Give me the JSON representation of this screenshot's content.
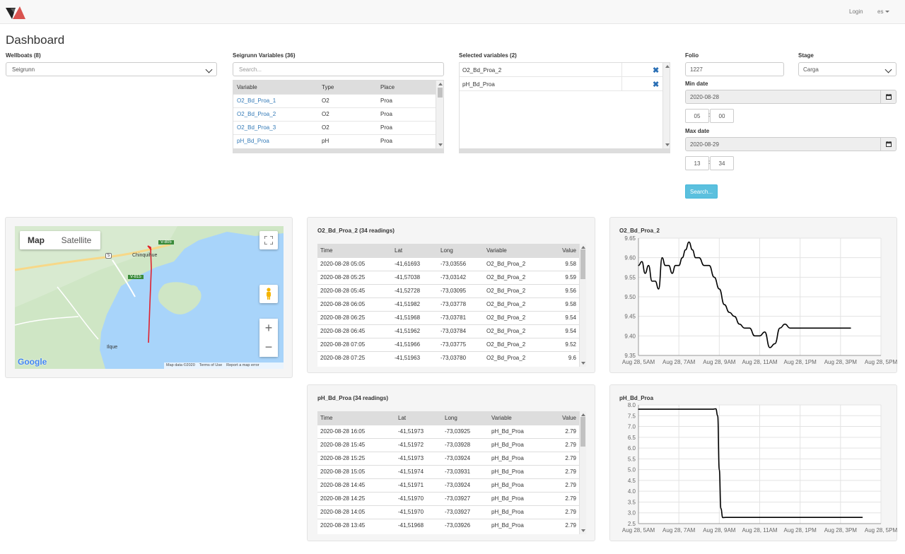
{
  "nav": {
    "login": "Login",
    "lang": "es"
  },
  "page_title": "Dashboard",
  "wellboats": {
    "label": "Wellboats (8)",
    "value": "Seigrunn"
  },
  "variables": {
    "label": "Seigrunn Variables (36)",
    "search_placeholder": "Search...",
    "columns": [
      "Variable",
      "Type",
      "Place"
    ],
    "rows": [
      [
        "O2_Bd_Proa_1",
        "O2",
        "Proa"
      ],
      [
        "O2_Bd_Proa_2",
        "O2",
        "Proa"
      ],
      [
        "O2_Bd_Proa_3",
        "O2",
        "Proa"
      ],
      [
        "pH_Bd_Proa",
        "pH",
        "Proa"
      ]
    ]
  },
  "selected": {
    "label": "Selected variables (2)",
    "items": [
      "O2_Bd_Proa_2",
      "pH_Bd_Proa"
    ]
  },
  "folio": {
    "label": "Folio",
    "value": "1227"
  },
  "stage": {
    "label": "Stage",
    "value": "Carga"
  },
  "min_date": {
    "label": "Min date",
    "value": "2020-08-28",
    "hour": "05",
    "minute": "00"
  },
  "max_date": {
    "label": "Max date",
    "value": "2020-08-29",
    "hour": "13",
    "minute": "34"
  },
  "search_button": "Search...",
  "map": {
    "tab_map": "Map",
    "tab_satellite": "Satellite",
    "places": [
      "Chinquihue",
      "Ilque"
    ],
    "roads": [
      "V-805",
      "V-815",
      "5"
    ],
    "google": "Google",
    "attribution": [
      "Map data ©2020",
      "Terms of Use",
      "Report a map error"
    ],
    "colors": {
      "water": "#a8d4fa",
      "land": "#cfe6c5",
      "track": "#e0202d"
    }
  },
  "table_o2": {
    "title": "O2_Bd_Proa_2 (34 readings)",
    "columns": [
      "Time",
      "Lat",
      "Long",
      "Variable",
      "Value"
    ],
    "rows": [
      [
        "2020-08-28 05:05",
        "-41,61693",
        "-73,03556",
        "O2_Bd_Proa_2",
        "9.58"
      ],
      [
        "2020-08-28 05:25",
        "-41,57038",
        "-73,03142",
        "O2_Bd_Proa_2",
        "9.59"
      ],
      [
        "2020-08-28 05:45",
        "-41,52728",
        "-73,03095",
        "O2_Bd_Proa_2",
        "9.56"
      ],
      [
        "2020-08-28 06:05",
        "-41,51982",
        "-73,03778",
        "O2_Bd_Proa_2",
        "9.58"
      ],
      [
        "2020-08-28 06:25",
        "-41,51968",
        "-73,03781",
        "O2_Bd_Proa_2",
        "9.54"
      ],
      [
        "2020-08-28 06:45",
        "-41,51962",
        "-73,03784",
        "O2_Bd_Proa_2",
        "9.54"
      ],
      [
        "2020-08-28 07:05",
        "-41,51966",
        "-73,03775",
        "O2_Bd_Proa_2",
        "9.52"
      ],
      [
        "2020-08-28 07:25",
        "-41,51963",
        "-73,03780",
        "O2_Bd_Proa_2",
        "9.6"
      ]
    ]
  },
  "table_ph": {
    "title": "pH_Bd_Proa (34 readings)",
    "columns": [
      "Time",
      "Lat",
      "Long",
      "Variable",
      "Value"
    ],
    "rows": [
      [
        "2020-08-28 16:05",
        "-41,51973",
        "-73,03925",
        "pH_Bd_Proa",
        "2.79"
      ],
      [
        "2020-08-28 15:45",
        "-41,51972",
        "-73,03928",
        "pH_Bd_Proa",
        "2.79"
      ],
      [
        "2020-08-28 15:25",
        "-41,51973",
        "-73,03924",
        "pH_Bd_Proa",
        "2.79"
      ],
      [
        "2020-08-28 15:05",
        "-41,51974",
        "-73,03931",
        "pH_Bd_Proa",
        "2.79"
      ],
      [
        "2020-08-28 14:45",
        "-41,51971",
        "-73,03924",
        "pH_Bd_Proa",
        "2.79"
      ],
      [
        "2020-08-28 14:25",
        "-41,51970",
        "-73,03927",
        "pH_Bd_Proa",
        "2.79"
      ],
      [
        "2020-08-28 14:05",
        "-41,51970",
        "-73,03927",
        "pH_Bd_Proa",
        "2.79"
      ],
      [
        "2020-08-28 13:45",
        "-41,51968",
        "-73,03926",
        "pH_Bd_Proa",
        "2.79"
      ]
    ]
  },
  "chart_data": [
    {
      "type": "line",
      "title": "O2_Bd_Proa_2",
      "x_ticks": [
        "Aug 28, 5AM",
        "Aug 28, 7AM",
        "Aug 28, 9AM",
        "Aug 28, 11AM",
        "Aug 28, 1PM",
        "Aug 28, 3PM",
        "Aug 28, 5PM"
      ],
      "xlim": [
        5,
        17
      ],
      "ylim": [
        9.35,
        9.65
      ],
      "y_ticks": [
        "9.35",
        "9.40",
        "9.45",
        "9.50",
        "9.55",
        "9.60",
        "9.65"
      ],
      "grid": true,
      "color": "#000000",
      "x": [
        5.0,
        5.17,
        5.33,
        5.5,
        5.67,
        5.83,
        6.0,
        6.17,
        6.33,
        6.5,
        6.67,
        6.83,
        7.0,
        7.17,
        7.33,
        7.5,
        7.67,
        7.83,
        8.0,
        8.25,
        8.5,
        8.75,
        9.0,
        9.25,
        9.5,
        9.75,
        10.0,
        10.25,
        10.5,
        10.75,
        11.0,
        11.25,
        11.5,
        11.75,
        12.0,
        12.25,
        12.5,
        12.75,
        13.0,
        13.25,
        13.5,
        13.75,
        14.0,
        14.25,
        14.5,
        14.75,
        15.0,
        15.17,
        15.33,
        15.5
      ],
      "values": [
        9.58,
        9.59,
        9.56,
        9.58,
        9.54,
        9.54,
        9.52,
        9.6,
        9.58,
        9.58,
        9.56,
        9.58,
        9.58,
        9.6,
        9.62,
        9.64,
        9.62,
        9.6,
        9.6,
        9.58,
        9.58,
        9.55,
        9.52,
        9.48,
        9.46,
        9.45,
        9.43,
        9.42,
        9.42,
        9.4,
        9.4,
        9.41,
        9.37,
        9.38,
        9.42,
        9.43,
        9.42,
        9.42,
        9.42,
        9.42,
        9.42,
        9.42,
        9.42,
        9.42,
        9.42,
        9.42,
        9.42,
        9.42,
        9.42,
        9.42
      ]
    },
    {
      "type": "line",
      "title": "pH_Bd_Proa",
      "x_ticks": [
        "Aug 28, 5AM",
        "Aug 28, 7AM",
        "Aug 28, 9AM",
        "Aug 28, 11AM",
        "Aug 28, 1PM",
        "Aug 28, 3PM",
        "Aug 28, 5PM"
      ],
      "xlim": [
        5,
        17
      ],
      "ylim": [
        2.5,
        8.0
      ],
      "y_ticks": [
        "2.5",
        "3.0",
        "3.5",
        "4.0",
        "4.5",
        "5.0",
        "5.5",
        "6.0",
        "6.5",
        "7.0",
        "7.5",
        "8.0"
      ],
      "grid": true,
      "color": "#000000",
      "x": [
        5.0,
        6.0,
        7.0,
        8.0,
        8.67,
        8.83,
        8.92,
        9.0,
        9.08,
        9.17,
        9.33,
        10.0,
        11.0,
        12.0,
        13.0,
        14.0,
        15.0,
        16.08
      ],
      "values": [
        7.8,
        7.8,
        7.8,
        7.8,
        7.8,
        7.82,
        7.5,
        5.0,
        3.2,
        2.78,
        2.79,
        2.79,
        2.79,
        2.79,
        2.79,
        2.79,
        2.79,
        2.79
      ]
    }
  ]
}
